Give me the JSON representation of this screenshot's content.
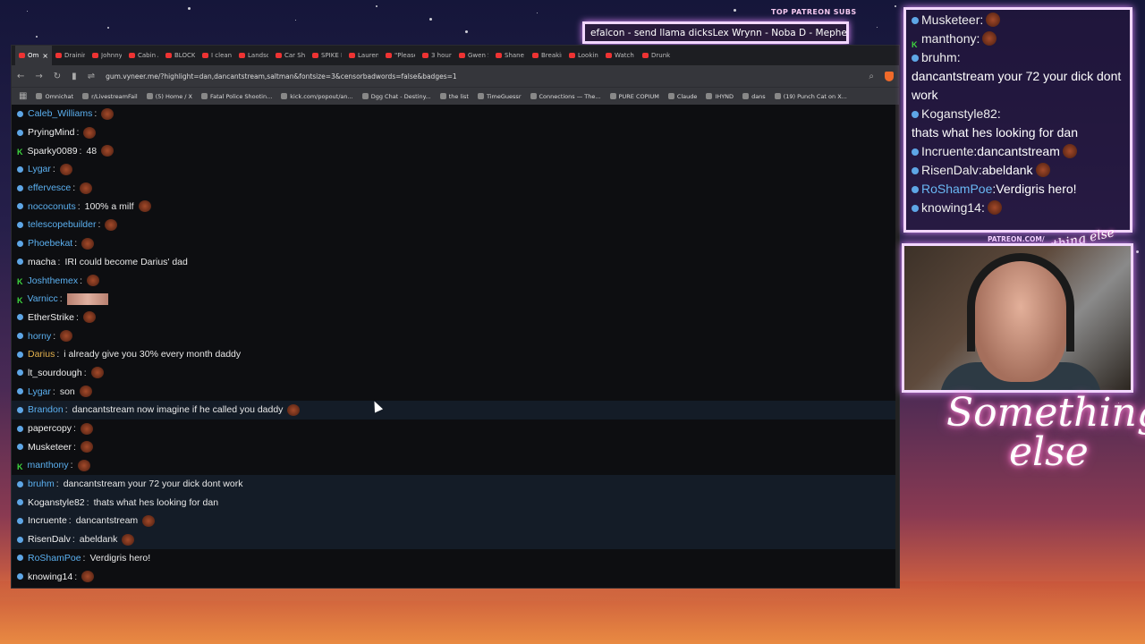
{
  "overlay": {
    "patreon_title": "TOP PATREON SUBS",
    "ticker_text": "efalcon - send llama dicksLex Wrynn - Noba D - Mephes",
    "cam_label": "PATREON.COM/",
    "logo_line1": "Something",
    "logo_line2": "else",
    "small_logo": "Anything else",
    "chat": [
      {
        "user": "Musketeer",
        "text": "",
        "badge": "blue"
      },
      {
        "user": "manthony",
        "text": "",
        "badge": "k"
      },
      {
        "user": "bruhm",
        "text": "dancantstream your 72 your dick dont work",
        "badge": "blue"
      },
      {
        "user": "Koganstyle82",
        "text": "thats what hes looking for dan",
        "badge": "blue"
      },
      {
        "user": "Incruente",
        "text": "dancantstream",
        "badge": "blue"
      },
      {
        "user": "RisenDalv",
        "text": "abeldank",
        "badge": "blue"
      },
      {
        "user": "RoShamPoe",
        "text": "Verdigris hero!",
        "badge": "blue",
        "color": "blue"
      },
      {
        "user": "knowing14",
        "text": "",
        "badge": "blue"
      }
    ]
  },
  "browser": {
    "tabs": [
      "Om",
      "Drainin",
      "Johnny",
      "Cabin A",
      "BLOCKE",
      "I cleane",
      "Landsc",
      "Car Shi",
      "SPIKE M",
      "Lauren",
      "\"Please",
      "3 hours",
      "Gwen S",
      "Shane C",
      "Breakin",
      "Lookin",
      "Watch",
      "Drunk V"
    ],
    "url": "gum.vyneer.me/?highlight=dan,dancantstream,saltman&fontsize=3&censorbadwords=false&badges=1",
    "bookmarks": [
      "Omnichat",
      "r/LivestreamFail",
      "(5) Home / X",
      "Fatal Police Shootin...",
      "kick.com/popout/an...",
      "Dgg Chat - Destiny...",
      "the list",
      "TimeGuessr",
      "Connections — The...",
      "PURE COPIUM",
      "Claude",
      "IHYND",
      "dans",
      "(19) Punch Cat on X..."
    ]
  },
  "chat": [
    {
      "user": "Caleb_Williams",
      "text": "",
      "badge": "blue",
      "color": "blue",
      "emote": true
    },
    {
      "user": "PryingMind",
      "text": "",
      "badge": "blue",
      "emote": true
    },
    {
      "user": "Sparky0089",
      "text": "48",
      "badge": "k",
      "emote": true
    },
    {
      "user": "Lygar",
      "text": "",
      "badge": "blue",
      "color": "blue",
      "emote": true
    },
    {
      "user": "effervesce",
      "text": "",
      "badge": "blue",
      "color": "blue",
      "emote": true
    },
    {
      "user": "nococonuts",
      "text": "100% a milf",
      "badge": "blue",
      "color": "blue",
      "emote": true
    },
    {
      "user": "telescopebuilder",
      "text": "",
      "badge": "blue",
      "color": "blue",
      "emote": true
    },
    {
      "user": "Phoebekat",
      "text": "",
      "badge": "blue",
      "color": "blue",
      "emote": true
    },
    {
      "user": "macha",
      "text": "IRI could become Darius' dad",
      "badge": "blue"
    },
    {
      "user": "Joshthemex",
      "text": "",
      "badge": "k",
      "color": "blue",
      "emote": true
    },
    {
      "user": "Varnicc",
      "text": "",
      "badge": "k",
      "color": "blue",
      "emote": true,
      "wide": true
    },
    {
      "user": "EtherStrike",
      "text": "",
      "badge": "blue",
      "emote": true
    },
    {
      "user": "horny",
      "text": "",
      "badge": "blue",
      "color": "blue",
      "emote": true
    },
    {
      "user": "Darius",
      "text": "i already give you 30% every month daddy",
      "badge": "blue",
      "color": "gold"
    },
    {
      "user": "lt_sourdough",
      "text": "",
      "badge": "blue",
      "emote": true
    },
    {
      "user": "Lygar",
      "text": "son",
      "badge": "blue",
      "color": "blue",
      "emote": true
    },
    {
      "user": "Brandon",
      "text": "dancantstream now imagine if he called you daddy",
      "badge": "blue",
      "color": "blue",
      "emote": true,
      "hl": true
    },
    {
      "user": "papercopy",
      "text": "",
      "badge": "blue",
      "emote": true
    },
    {
      "user": "Musketeer",
      "text": "",
      "badge": "blue",
      "emote": true
    },
    {
      "user": "manthony",
      "text": "",
      "badge": "k",
      "color": "blue",
      "emote": true
    },
    {
      "user": "bruhm",
      "text": "dancantstream your 72 your dick dont work",
      "badge": "blue",
      "color": "blue",
      "hl": true
    },
    {
      "user": "Koganstyle82",
      "text": "thats what hes looking for dan",
      "badge": "blue",
      "hl": true
    },
    {
      "user": "Incruente",
      "text": "dancantstream",
      "badge": "blue",
      "emote": true,
      "hl": true
    },
    {
      "user": "RisenDalv",
      "text": "abeldank",
      "badge": "blue",
      "emote": true,
      "hl": true
    },
    {
      "user": "RoShamPoe",
      "text": "Verdigris hero!",
      "badge": "blue",
      "color": "blue"
    },
    {
      "user": "knowing14",
      "text": "",
      "badge": "blue",
      "emote": true
    }
  ]
}
